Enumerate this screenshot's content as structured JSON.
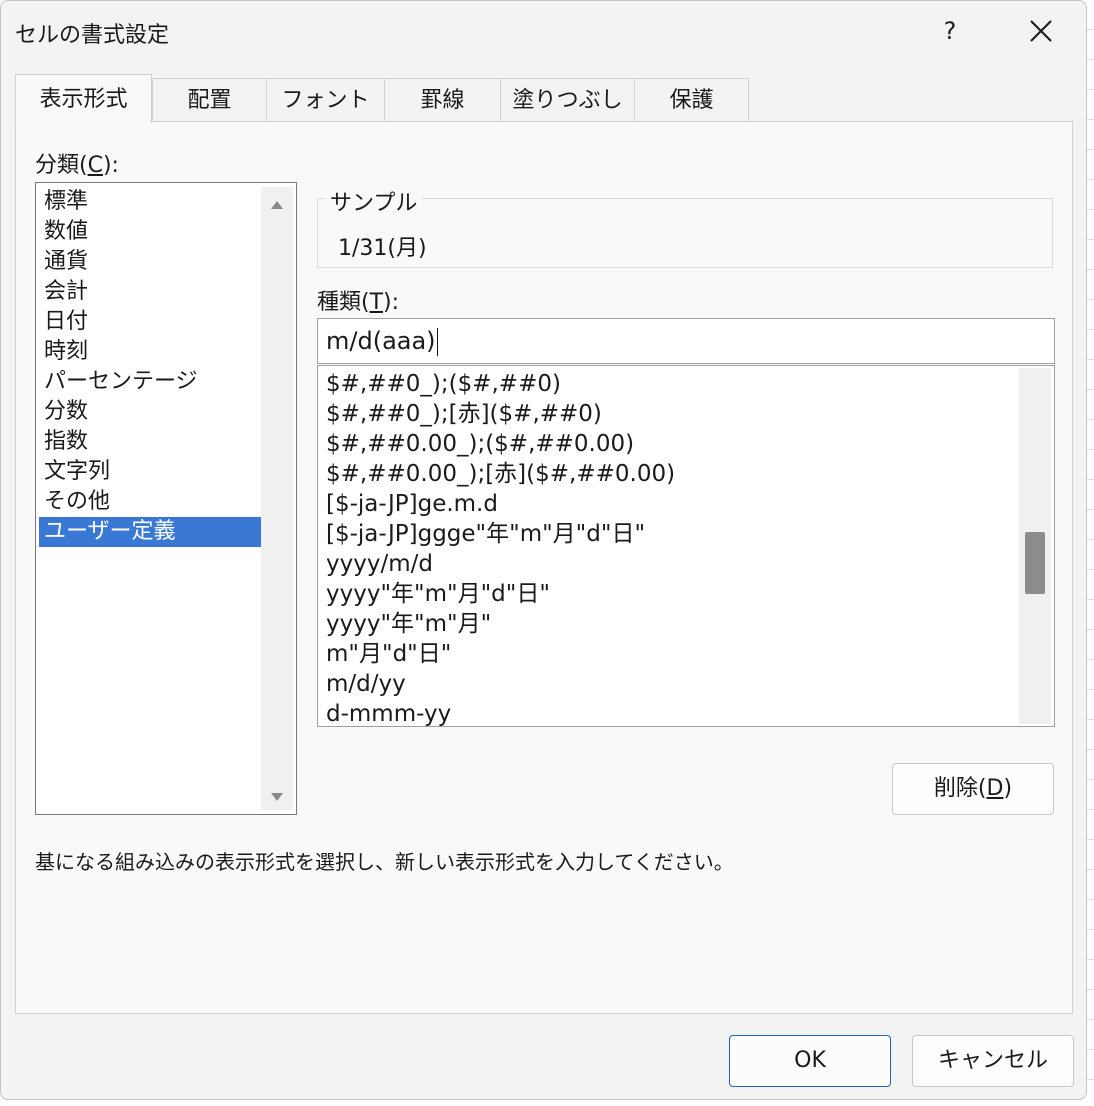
{
  "dialog": {
    "title": "セルの書式設定",
    "help_label": "?"
  },
  "tabs": [
    {
      "label": "表示形式",
      "active": true
    },
    {
      "label": "配置"
    },
    {
      "label": "フォント"
    },
    {
      "label": "罫線"
    },
    {
      "label": "塗りつぶし"
    },
    {
      "label": "保護"
    }
  ],
  "category": {
    "label_prefix": "分類(",
    "label_key": "C",
    "label_suffix": "):",
    "items": [
      "標準",
      "数値",
      "通貨",
      "会計",
      "日付",
      "時刻",
      "パーセンテージ",
      "分数",
      "指数",
      "文字列",
      "その他",
      "ユーザー定義"
    ],
    "selected": "ユーザー定義"
  },
  "sample": {
    "label": "サンプル",
    "value": "1/31(月)"
  },
  "type": {
    "label_prefix": "種類(",
    "label_key": "T",
    "label_suffix": "):",
    "input_value": "m/d(aaa)",
    "formats": [
      "$#,##0_);($#,##0)",
      "$#,##0_);[赤]($#,##0)",
      "$#,##0.00_);($#,##0.00)",
      "$#,##0.00_);[赤]($#,##0.00)",
      "[$-ja-JP]ge.m.d",
      "[$-ja-JP]ggge\"年\"m\"月\"d\"日\"",
      "yyyy/m/d",
      "yyyy\"年\"m\"月\"d\"日\"",
      "yyyy\"年\"m\"月\"",
      "m\"月\"d\"日\"",
      "m/d/yy",
      "d-mmm-yy"
    ]
  },
  "delete_button": {
    "label_prefix": "削除(",
    "label_key": "D",
    "label_suffix": ")"
  },
  "description": "基になる組み込みの表示形式を選択し、新しい表示形式を入力してください。",
  "footer": {
    "ok_label": "OK",
    "cancel_label": "キャンセル"
  },
  "colors": {
    "selection": "#3a78d6",
    "dialog_bg": "#f3f3f3",
    "primary_border": "#1f63c4"
  }
}
